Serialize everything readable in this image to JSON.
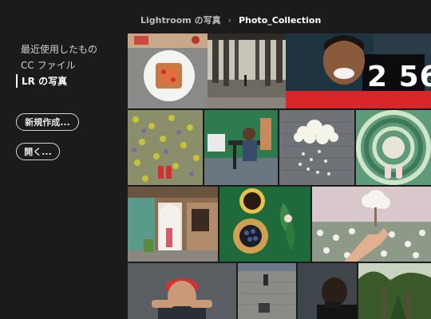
{
  "sidebar": {
    "items": [
      {
        "label": "最近使用したもの"
      },
      {
        "label": "CC ファイル"
      },
      {
        "label": "LR の写真"
      }
    ],
    "new_button": "新規作成...",
    "open_button": "開く..."
  },
  "breadcrumb": {
    "parent": "Lightroom の写真",
    "separator": "›",
    "current": "Photo_Collection"
  },
  "photos": {
    "clock_digits": "2 56"
  },
  "colors": {
    "background": "#1b1b1b",
    "text": "#cfcfcf",
    "active_text": "#ffffff"
  }
}
